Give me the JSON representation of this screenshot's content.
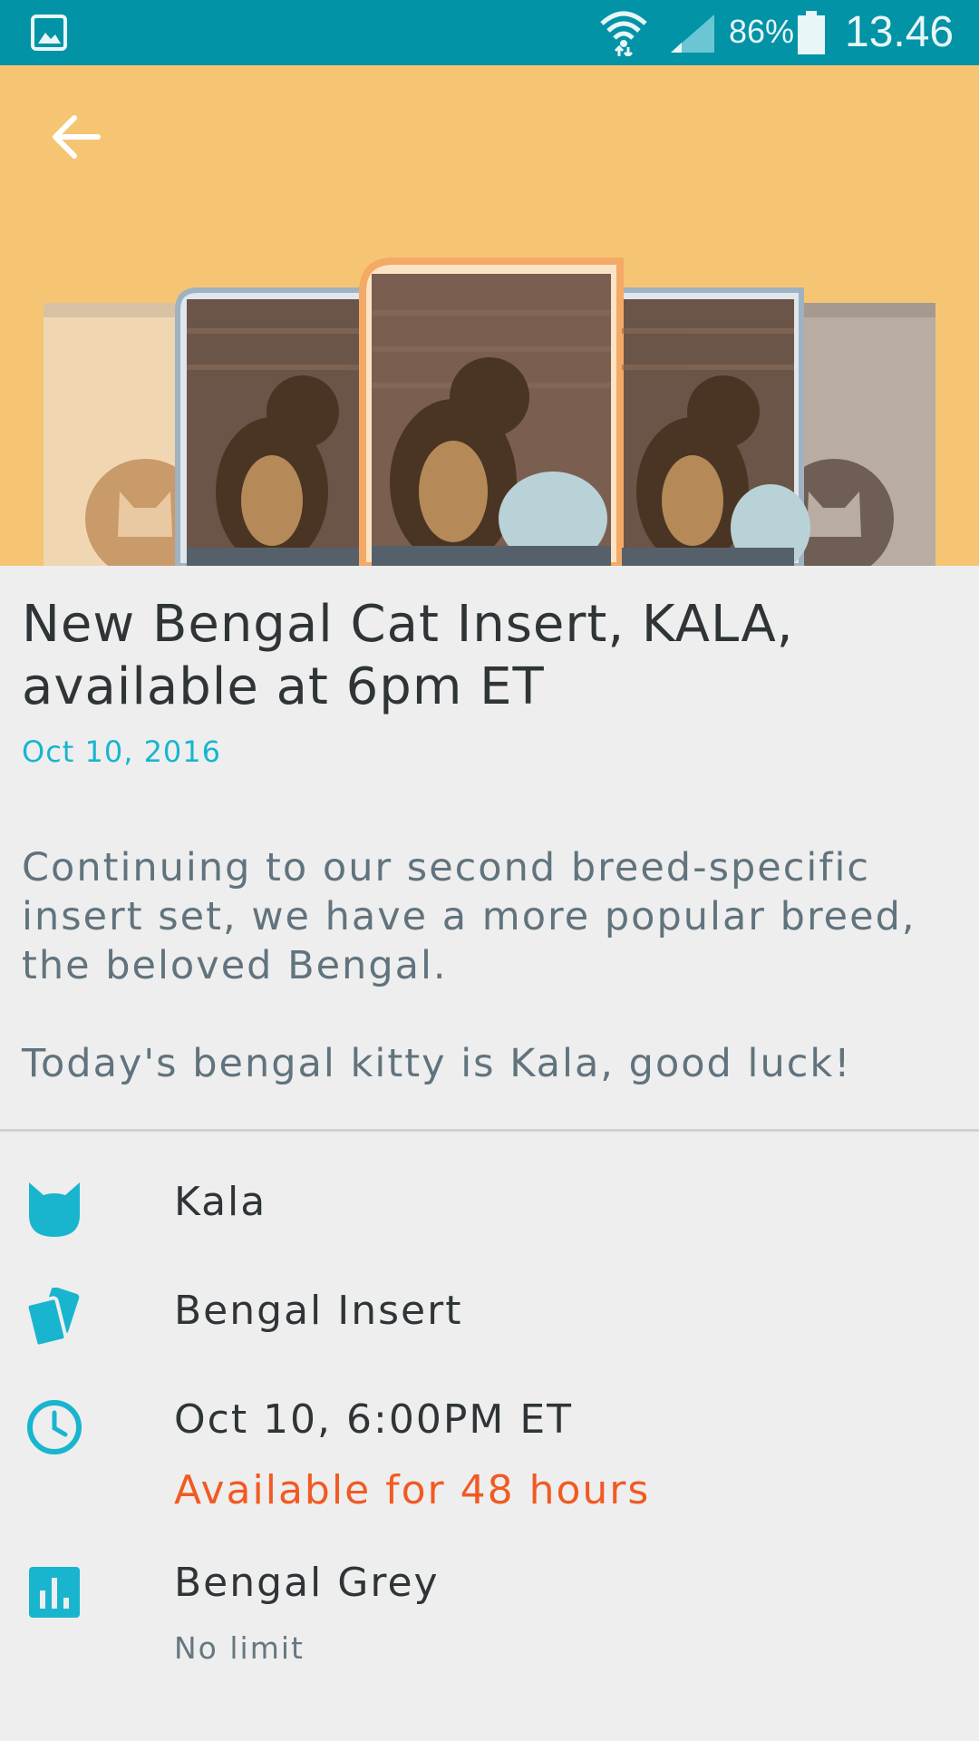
{
  "status_bar": {
    "battery_percent": "86%",
    "time": "13.46",
    "color": "#0293a6"
  },
  "header": {
    "back_icon": "arrow-left-icon",
    "hero_bg": "#f6c573"
  },
  "article": {
    "title": "New Bengal Cat Insert, KALA, available at 6pm ET",
    "date": "Oct 10, 2016",
    "body": "Continuing to our second breed-specific insert set, we have a more popular breed, the beloved Bengal.\n\nToday's bengal kitty is Kala, good luck!"
  },
  "details": {
    "cat_name": "Kala",
    "cat_icon": "cat-head-icon",
    "insert_name": "Bengal Insert",
    "insert_icon": "cards-icon",
    "release_time": "Oct 10, 6:00PM ET",
    "availability": "Available for 48 hours",
    "clock_icon": "clock-icon",
    "variant_name": "Bengal Grey",
    "variant_limit": "No limit",
    "stats_icon": "bar-chart-icon",
    "accent_color": "#19b5cf",
    "highlight_color": "#f15a22"
  }
}
